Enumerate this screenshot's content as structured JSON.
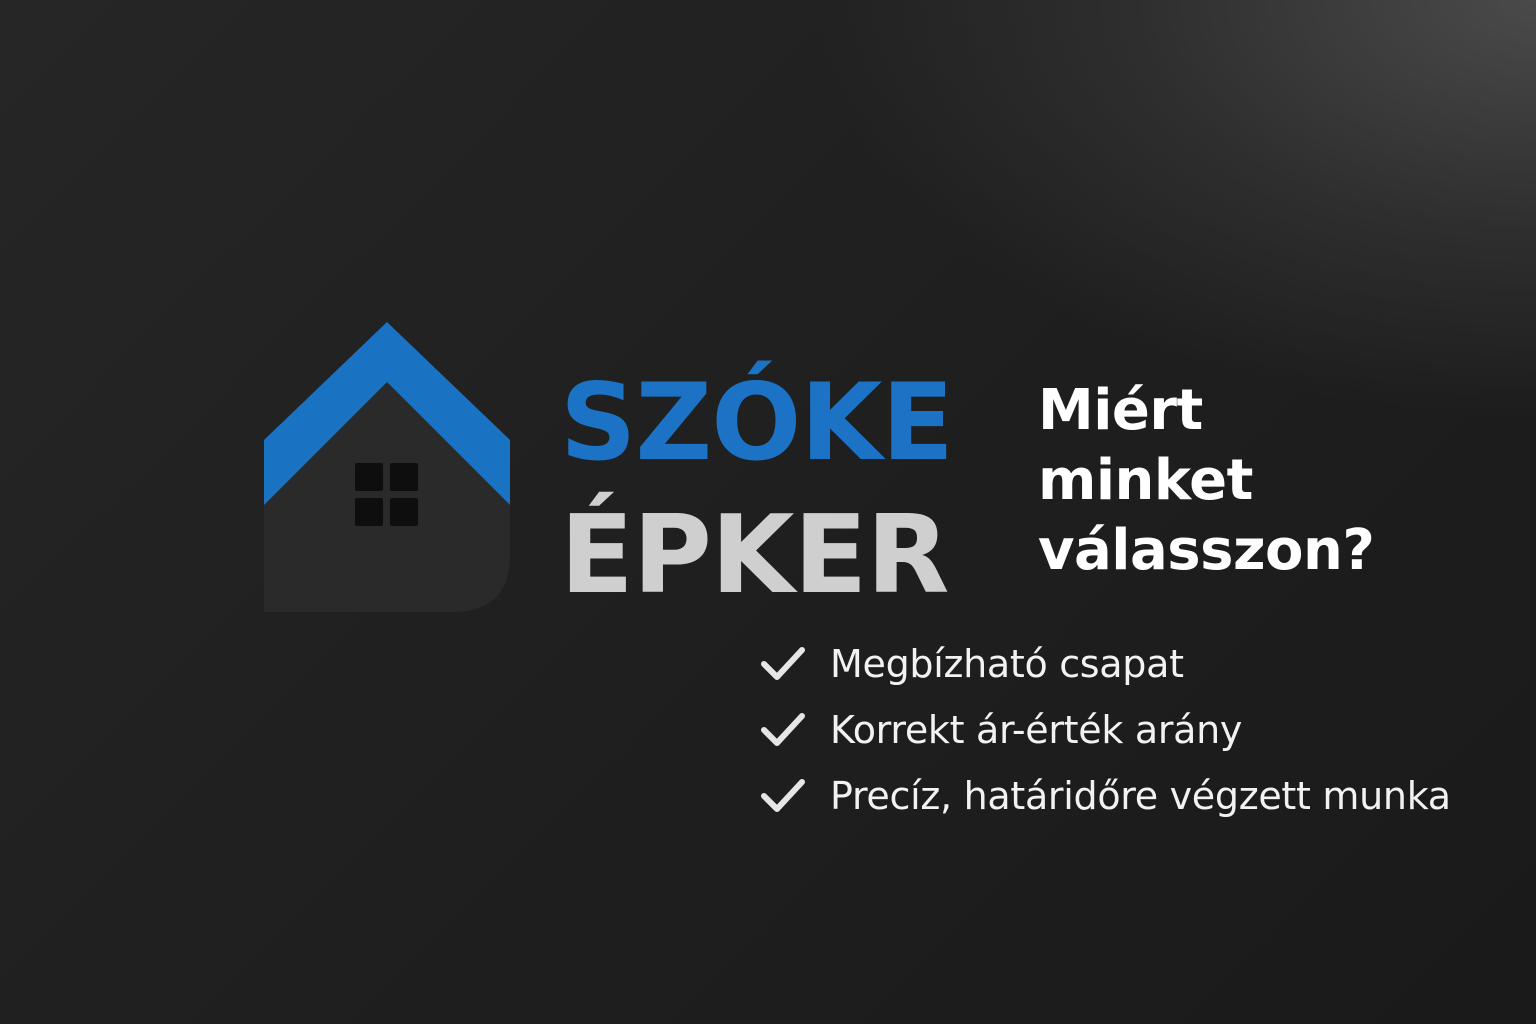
{
  "brand": {
    "line1": "SZÓKE",
    "line2": "ÉPKER",
    "line1_color": "#1c72c4",
    "line2_color": "#cfcfcf",
    "roof_color": "#1a72c3",
    "house_body_color": "#2a2a2a",
    "window_color": "#0e0e0e",
    "icon": "house-logo-icon"
  },
  "headline": {
    "line1": "Miért",
    "line2": "minket",
    "line3": "válasszon?"
  },
  "benefits": {
    "icon": "checkmark-icon",
    "check_color": "#e6e6e6",
    "text_color": "#f2f2f2",
    "items": [
      "Megbízható csapat",
      "Korrekt ár-érték arány",
      "Precíz, határidőre végzett munka"
    ]
  }
}
